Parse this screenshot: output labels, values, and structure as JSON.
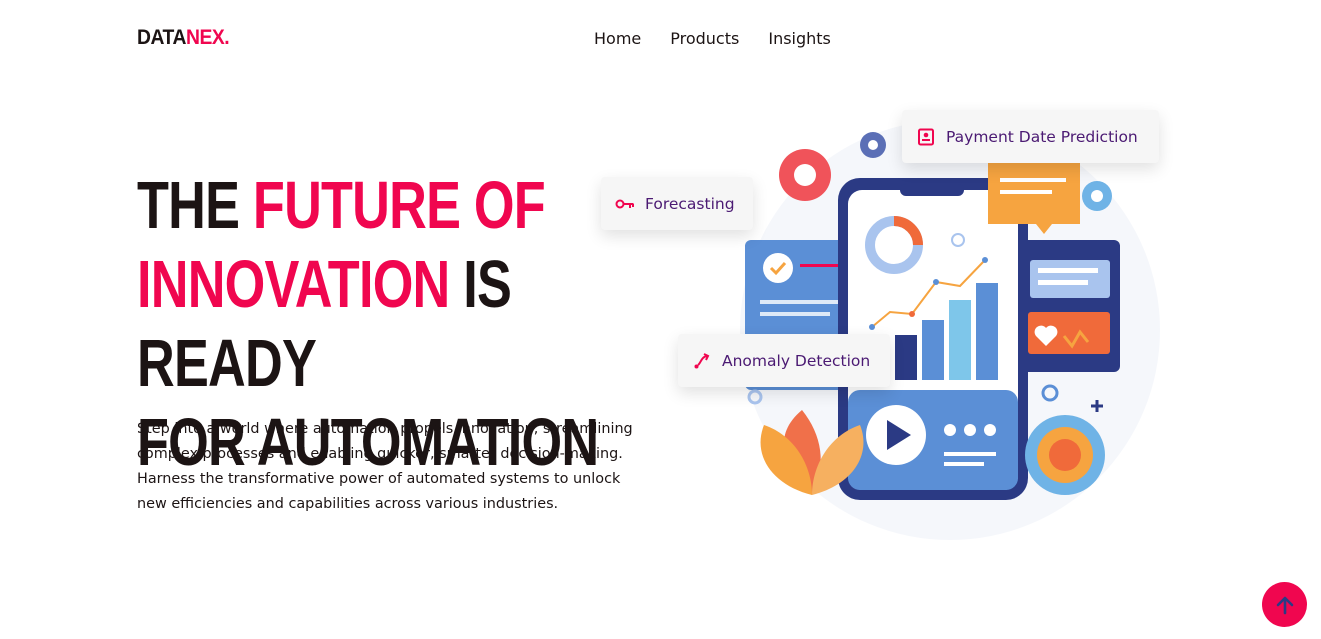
{
  "logo": {
    "main": "DATA",
    "accent": "NEX."
  },
  "nav": {
    "items": [
      "Home",
      "Products",
      "Insights"
    ]
  },
  "hero": {
    "title_part1": "THE ",
    "title_part2": "FUTURE OF",
    "title_part3": "INNOVATION",
    "title_part4": " IS READY",
    "title_part5": "FOR AUTOMATION",
    "text_line1": "Step into a world where automation propels innovation, streamlining",
    "text_line2": "complex processes and enabling quicker, smarter decision-making.",
    "text_line3": "Harness the transformative power of automated systems to unlock",
    "text_line4": "new efficiencies and capabilities across various industries."
  },
  "chips": {
    "payment": "Payment Date Prediction",
    "forecasting": "Forecasting",
    "anomaly": "Anomaly Detection"
  },
  "colors": {
    "accent": "#f0064f",
    "chip_text": "#4b1a73",
    "dark": "#1c1414",
    "navy": "#2b3a84",
    "blue": "#5b8fd6",
    "orange": "#f6a440"
  },
  "icons": {
    "payment": "receipt-icon",
    "forecasting": "key-icon",
    "anomaly": "trend-arrow-icon",
    "scroll_top": "arrow-up-icon"
  }
}
